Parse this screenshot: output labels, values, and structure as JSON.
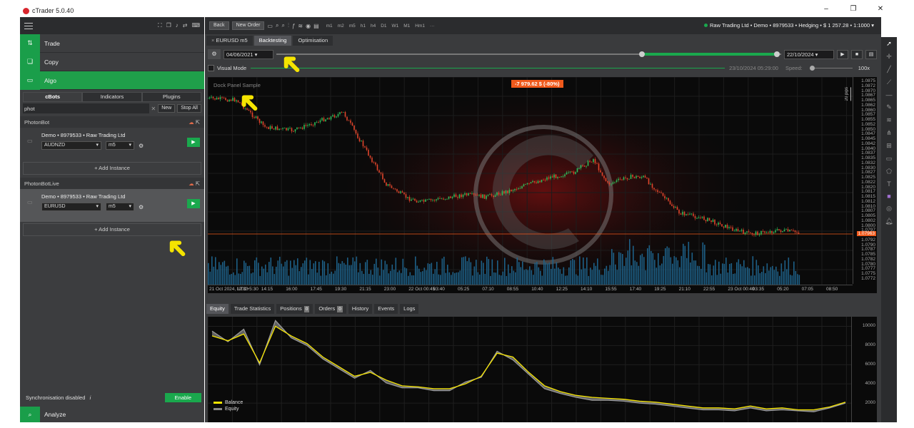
{
  "app": {
    "title": "cTrader 5.0.40"
  },
  "window_controls": [
    "–",
    "❐",
    "✕"
  ],
  "sidebar": {
    "nav": [
      {
        "label": "Trade",
        "icon": "trade-icon"
      },
      {
        "label": "Copy",
        "icon": "copy-icon"
      },
      {
        "label": "Algo",
        "icon": "algo-icon",
        "active": true
      }
    ],
    "algo_tabs": [
      "cBots",
      "Indicators",
      "Plugins"
    ],
    "search": {
      "value": "phot",
      "new_label": "New",
      "stop_all_label": "Stop All"
    },
    "groups": [
      {
        "name": "PhotonBot",
        "instance": {
          "account": "Demo • 8979533 • Raw Trading Ltd",
          "symbol": "AUDNZD",
          "timeframe": "m5"
        },
        "add_label": "Add Instance"
      },
      {
        "name": "PhotonBotLive",
        "instance": {
          "account": "Demo • 8979533 • Raw Trading Ltd",
          "symbol": "EURUSD",
          "timeframe": "m5"
        },
        "add_label": "Add Instance"
      }
    ],
    "sync_text": "Synchronisation disabled",
    "enable_label": "Enable",
    "analyze_label": "Analyze"
  },
  "toolbar": {
    "back": "Back",
    "new_order": "New Order",
    "timeframes": [
      "m1",
      "m2",
      "m5",
      "h1",
      "h4",
      "D1",
      "W1",
      "M1",
      "Hm1"
    ],
    "account": "Raw Trading Ltd • Demo • 8979533 • Hedging • $ 1 257.28 • 1:1000"
  },
  "chart_tabs": [
    "EURUSD   m5",
    "Backtesting",
    "Optimisation"
  ],
  "backtest": {
    "start_date": "04/06/2021",
    "end_date": "22/10/2024",
    "visual_mode": "Visual Mode",
    "current_time": "23/10/2024 05:29:00",
    "speed_label": "Speed:",
    "speed_value": "100x"
  },
  "chart": {
    "dock_label": "Dock Panel Sample",
    "pnl": "-7 979.62 $ (-80%)",
    "pips": "20 pips",
    "current_price": "1.07963",
    "y_ticks": [
      "1.0875",
      "1.0872",
      "1.0870",
      "1.0867",
      "1.0865",
      "1.0862",
      "1.0860",
      "1.0857",
      "1.0855",
      "1.0852",
      "1.0850",
      "1.0847",
      "1.0845",
      "1.0842",
      "1.0840",
      "1.0837",
      "1.0835",
      "1.0832",
      "1.0830",
      "1.0827",
      "1.0825",
      "1.0822",
      "1.0820",
      "1.0817",
      "1.0815",
      "1.0812",
      "1.0810",
      "1.0807",
      "1.0805",
      "1.0802",
      "1.0800",
      "1.0797",
      "1.0795",
      "1.0792",
      "1.0790",
      "1.0787",
      "1.0785",
      "1.0782",
      "1.0780",
      "1.0777",
      "1.0775",
      "1.0772"
    ],
    "x_ticks": [
      "21 Oct 2024, UTC+5:30",
      "12:30",
      "14:15",
      "16:00",
      "17:45",
      "19:30",
      "21:15",
      "23:00",
      "22 Oct 00:45",
      "03:40",
      "05:25",
      "07:10",
      "08:55",
      "10:40",
      "12:25",
      "14:10",
      "15:55",
      "17:40",
      "19:25",
      "21:10",
      "22:55",
      "23 Oct 00:40",
      "03:35",
      "05:20",
      "07:05",
      "08:50"
    ]
  },
  "bottom_tabs": [
    {
      "label": "Equity",
      "selected": true
    },
    {
      "label": "Trade Statistics"
    },
    {
      "label": "Positions",
      "badge": "0"
    },
    {
      "label": "Orders",
      "badge": "0"
    },
    {
      "label": "History"
    },
    {
      "label": "Events"
    },
    {
      "label": "Logs"
    }
  ],
  "equity": {
    "y_ticks": [
      "10000",
      "8000",
      "6000",
      "4000",
      "2000"
    ],
    "legend": [
      {
        "name": "Balance",
        "color": "#f5e400"
      },
      {
        "name": "Equity",
        "color": "#888888"
      }
    ],
    "chart_data": {
      "type": "line",
      "ylim": [
        0,
        11000
      ],
      "series": [
        {
          "name": "Balance",
          "values": [
            9000,
            8500,
            9200,
            6200,
            10000,
            9000,
            8200,
            6800,
            5800,
            4800,
            5200,
            4400,
            3800,
            3700,
            3500,
            3500,
            4000,
            4800,
            7200,
            6800,
            5200,
            3800,
            3200,
            2800,
            2600,
            2500,
            2400,
            2200,
            2100,
            1900,
            1700,
            1500,
            1500,
            1400,
            1700,
            1400,
            1500,
            1300,
            1300,
            1600,
            2100
          ]
        },
        {
          "name": "Equity",
          "values": [
            9500,
            8400,
            9700,
            6000,
            10600,
            8800,
            8000,
            6600,
            5600,
            4600,
            5400,
            4100,
            3600,
            3600,
            3300,
            3300,
            4200,
            4700,
            7400,
            6500,
            5000,
            3500,
            3000,
            2600,
            2300,
            2300,
            2200,
            2000,
            1900,
            1700,
            1500,
            1300,
            1300,
            1200,
            1500,
            1200,
            1300,
            1200,
            1100,
            1500,
            2000
          ]
        }
      ]
    }
  }
}
